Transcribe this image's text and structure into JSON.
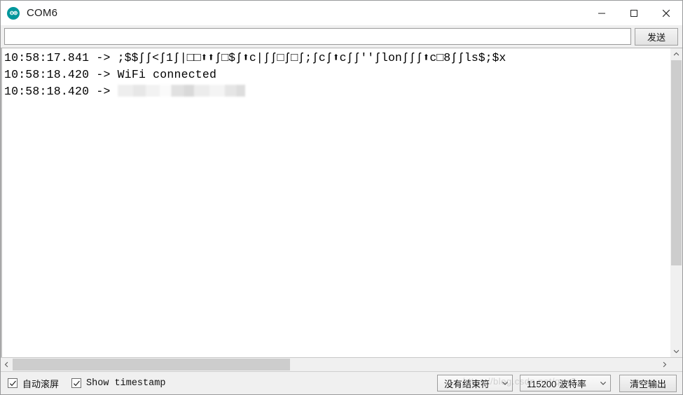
{
  "window": {
    "title": "COM6",
    "app_icon": "arduino-logo-icon",
    "accent_color": "#00979c",
    "controls": {
      "minimize": "minimize-icon",
      "maximize": "maximize-icon",
      "close": "close-icon"
    }
  },
  "send_bar": {
    "input_value": "",
    "input_placeholder": "",
    "send_label": "发送"
  },
  "console": {
    "lines": [
      {
        "timestamp": "10:58:17.841",
        "arrow": "->",
        "text": ";$$ʃʃ<ʃ1ʃ|□□⬆⬆ʃ□$ʃ⬆c|ʃʃ□ʃ□ʃ;ʃcʃ⬆cʃʃ''ʃlonʃʃʃ⬆c□8ʃʃls$;$x",
        "redacted": false
      },
      {
        "timestamp": "10:58:18.420",
        "arrow": "->",
        "text": "WiFi connected",
        "redacted": false
      },
      {
        "timestamp": "10:58:18.420",
        "arrow": "->",
        "text": "",
        "redacted": true
      }
    ]
  },
  "scrollbars": {
    "vertical": {
      "up_icon": "chevron-up-icon",
      "down_icon": "chevron-down-icon",
      "thumb_position_percent": 0,
      "thumb_size_percent": 72
    },
    "horizontal": {
      "left_icon": "chevron-left-icon",
      "right_icon": "chevron-right-icon",
      "thumb_position_percent": 0,
      "thumb_size_percent": 43
    }
  },
  "status_bar": {
    "autoscroll": {
      "label": "自动滚屏",
      "checked": true
    },
    "show_timestamp": {
      "label": "Show timestamp",
      "checked": true
    },
    "line_ending": {
      "selected": "没有结束符",
      "caret_icon": "chevron-down-icon"
    },
    "baud_rate": {
      "selected": "115200 波特率",
      "caret_icon": "chevron-down-icon"
    },
    "clear_output_label": "清空输出"
  },
  "watermark": {
    "text": "https://blog.csdn.net/qq_2"
  }
}
